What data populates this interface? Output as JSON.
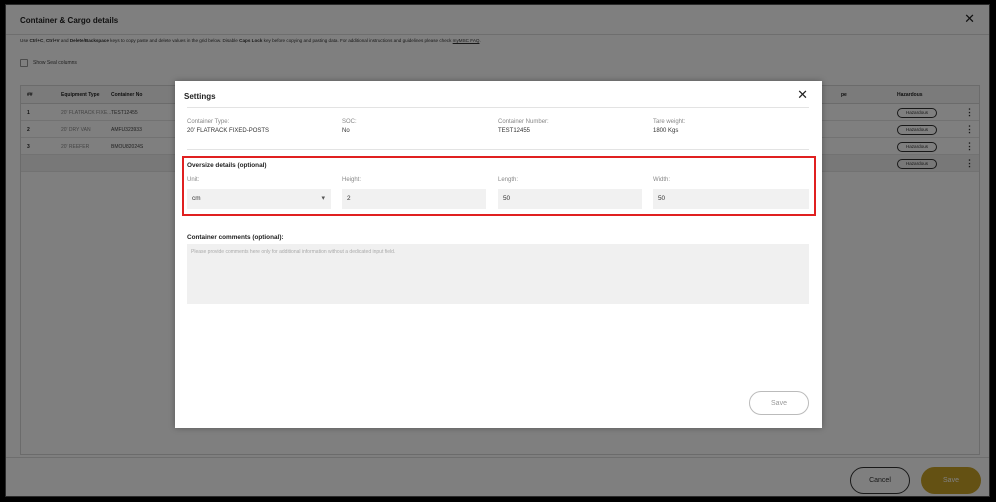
{
  "page": {
    "title": "Container & Cargo details",
    "help": {
      "p1": "Use ",
      "k1": "Ctrl+C",
      "p2": ", ",
      "k2": "Ctrl+V",
      "p3": " and ",
      "k3": "Delete/Backspace",
      "p4": " keys to copy paste and delete values in the grid below. Disable ",
      "k4": "Caps Lock",
      "p5": " key before copying and pasting data. For additional instructions and guidelines please check ",
      "link": "myMSC FAQ",
      "p6": "."
    },
    "show_seal_label": "Show Seal columns",
    "grid": {
      "headers": {
        "num": "##",
        "equipment": "Equipment Type",
        "container": "Container No",
        "type_partial": "pe",
        "hazardous": "Hazardous"
      },
      "rows": [
        {
          "num": "1",
          "equipment": "20' FLATRACK FIXE...",
          "container": "TEST12455",
          "hazardous": "Hazardous"
        },
        {
          "num": "2",
          "equipment": "20' DRY VAN",
          "container": "AMFU323933",
          "hazardous": "Hazardous"
        },
        {
          "num": "3",
          "equipment": "20' REEFER",
          "container": "BMOU82024S",
          "hazardous": "Hazardous"
        }
      ],
      "empty_row_hazardous": "Hazardous",
      "kebab": "⋮"
    },
    "cancel_label": "Cancel",
    "save_label": "Save",
    "close_glyph": "✕"
  },
  "modal": {
    "title": "Settings",
    "close_glyph": "✕",
    "info": {
      "container_type_label": "Container Type:",
      "container_type_value": "20' FLATRACK FIXED-POSTS",
      "soc_label": "SOC:",
      "soc_value": "No",
      "container_number_label": "Container Number:",
      "container_number_value": "TEST12455",
      "tare_weight_label": "Tare weight:",
      "tare_weight_value": "1800 Kgs"
    },
    "oversize": {
      "title": "Oversize details (optional)",
      "unit_label": "Unit:",
      "unit_value": "cm",
      "height_label": "Height:",
      "height_value": "2",
      "length_label": "Length:",
      "length_value": "50",
      "width_label": "Width:",
      "width_value": "50"
    },
    "comments": {
      "title": "Container comments (optional):",
      "placeholder": "Please provide comments here only for additional information without a dedicated input field."
    },
    "save_label": "Save"
  },
  "colors": {
    "accent": "#c9a227",
    "highlight_border": "#e02020"
  }
}
